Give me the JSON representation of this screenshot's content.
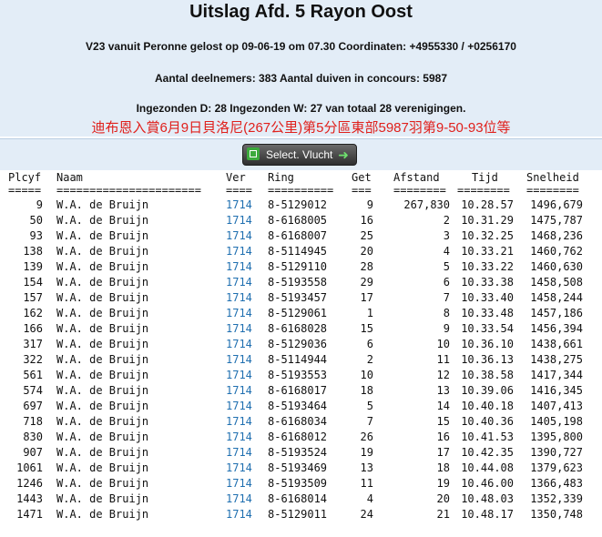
{
  "header": {
    "title": "Uitslag Afd. 5 Rayon Oost",
    "release_info": "V23 vanuit Peronne gelost op 09-06-19 om 07.30 Coordinaten: +4955330 / +0256170",
    "participants": "Aantal deelnemers: 383 Aantal duiven in concours: 5987",
    "submitted": "Ingezonden D: 28 Ingezonden W: 27 van totaal 28 verenigingen.",
    "chinese_note": "迪布恩入賞6月9日貝洛尼(267公里)第5分區東部5987羽第9-50-93位等"
  },
  "button": {
    "label": "Select. Vlucht",
    "left_icon": "flight-list-icon",
    "right_icon": "arrow-right-icon"
  },
  "colors": {
    "header_bg": "#e3edf7",
    "title_text": "#111111",
    "chinese_text": "#e0201c",
    "link": "#1f6fb0"
  },
  "table": {
    "headers": {
      "plcyf": "Plcyf",
      "naam": "Naam",
      "ver": "Ver",
      "ring": "Ring",
      "get": "Get",
      "afstand": "Afstand",
      "tijd": "Tijd",
      "snelheid": "Snelheid"
    },
    "separators": {
      "plcyf": "=====",
      "naam": "======================",
      "ver": "====",
      "ring": "==========",
      "get": "===",
      "afstand": "========",
      "tijd": "========",
      "snelheid": "========"
    },
    "rows": [
      {
        "plcyf": "9",
        "naam": "W.A. de Bruijn",
        "ver": "1714",
        "ring": "8-5129012",
        "get": "9",
        "afstand": "267,830",
        "tijd": "10.28.57",
        "snelheid": "1496,679"
      },
      {
        "plcyf": "50",
        "naam": "W.A. de Bruijn",
        "ver": "1714",
        "ring": "8-6168005",
        "get": "16",
        "afstand": "2",
        "tijd": "10.31.29",
        "snelheid": "1475,787"
      },
      {
        "plcyf": "93",
        "naam": "W.A. de Bruijn",
        "ver": "1714",
        "ring": "8-6168007",
        "get": "25",
        "afstand": "3",
        "tijd": "10.32.25",
        "snelheid": "1468,236"
      },
      {
        "plcyf": "138",
        "naam": "W.A. de Bruijn",
        "ver": "1714",
        "ring": "8-5114945",
        "get": "20",
        "afstand": "4",
        "tijd": "10.33.21",
        "snelheid": "1460,762"
      },
      {
        "plcyf": "139",
        "naam": "W.A. de Bruijn",
        "ver": "1714",
        "ring": "8-5129110",
        "get": "28",
        "afstand": "5",
        "tijd": "10.33.22",
        "snelheid": "1460,630"
      },
      {
        "plcyf": "154",
        "naam": "W.A. de Bruijn",
        "ver": "1714",
        "ring": "8-5193558",
        "get": "29",
        "afstand": "6",
        "tijd": "10.33.38",
        "snelheid": "1458,508"
      },
      {
        "plcyf": "157",
        "naam": "W.A. de Bruijn",
        "ver": "1714",
        "ring": "8-5193457",
        "get": "17",
        "afstand": "7",
        "tijd": "10.33.40",
        "snelheid": "1458,244"
      },
      {
        "plcyf": "162",
        "naam": "W.A. de Bruijn",
        "ver": "1714",
        "ring": "8-5129061",
        "get": "1",
        "afstand": "8",
        "tijd": "10.33.48",
        "snelheid": "1457,186"
      },
      {
        "plcyf": "166",
        "naam": "W.A. de Bruijn",
        "ver": "1714",
        "ring": "8-6168028",
        "get": "15",
        "afstand": "9",
        "tijd": "10.33.54",
        "snelheid": "1456,394"
      },
      {
        "plcyf": "317",
        "naam": "W.A. de Bruijn",
        "ver": "1714",
        "ring": "8-5129036",
        "get": "6",
        "afstand": "10",
        "tijd": "10.36.10",
        "snelheid": "1438,661"
      },
      {
        "plcyf": "322",
        "naam": "W.A. de Bruijn",
        "ver": "1714",
        "ring": "8-5114944",
        "get": "2",
        "afstand": "11",
        "tijd": "10.36.13",
        "snelheid": "1438,275"
      },
      {
        "plcyf": "561",
        "naam": "W.A. de Bruijn",
        "ver": "1714",
        "ring": "8-5193553",
        "get": "10",
        "afstand": "12",
        "tijd": "10.38.58",
        "snelheid": "1417,344"
      },
      {
        "plcyf": "574",
        "naam": "W.A. de Bruijn",
        "ver": "1714",
        "ring": "8-6168017",
        "get": "18",
        "afstand": "13",
        "tijd": "10.39.06",
        "snelheid": "1416,345"
      },
      {
        "plcyf": "697",
        "naam": "W.A. de Bruijn",
        "ver": "1714",
        "ring": "8-5193464",
        "get": "5",
        "afstand": "14",
        "tijd": "10.40.18",
        "snelheid": "1407,413"
      },
      {
        "plcyf": "718",
        "naam": "W.A. de Bruijn",
        "ver": "1714",
        "ring": "8-6168034",
        "get": "7",
        "afstand": "15",
        "tijd": "10.40.36",
        "snelheid": "1405,198"
      },
      {
        "plcyf": "830",
        "naam": "W.A. de Bruijn",
        "ver": "1714",
        "ring": "8-6168012",
        "get": "26",
        "afstand": "16",
        "tijd": "10.41.53",
        "snelheid": "1395,800"
      },
      {
        "plcyf": "907",
        "naam": "W.A. de Bruijn",
        "ver": "1714",
        "ring": "8-5193524",
        "get": "19",
        "afstand": "17",
        "tijd": "10.42.35",
        "snelheid": "1390,727"
      },
      {
        "plcyf": "1061",
        "naam": "W.A. de Bruijn",
        "ver": "1714",
        "ring": "8-5193469",
        "get": "13",
        "afstand": "18",
        "tijd": "10.44.08",
        "snelheid": "1379,623"
      },
      {
        "plcyf": "1246",
        "naam": "W.A. de Bruijn",
        "ver": "1714",
        "ring": "8-5193509",
        "get": "11",
        "afstand": "19",
        "tijd": "10.46.00",
        "snelheid": "1366,483"
      },
      {
        "plcyf": "1443",
        "naam": "W.A. de Bruijn",
        "ver": "1714",
        "ring": "8-6168014",
        "get": "4",
        "afstand": "20",
        "tijd": "10.48.03",
        "snelheid": "1352,339"
      },
      {
        "plcyf": "1471",
        "naam": "W.A. de Bruijn",
        "ver": "1714",
        "ring": "8-5129011",
        "get": "24",
        "afstand": "21",
        "tijd": "10.48.17",
        "snelheid": "1350,748"
      }
    ]
  }
}
